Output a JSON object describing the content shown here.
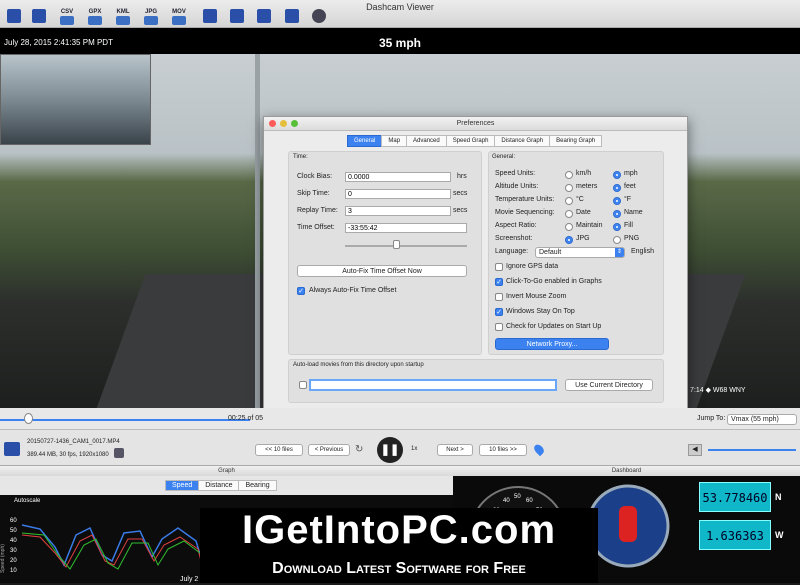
{
  "window": {
    "title": "Dashcam Viewer"
  },
  "toolbar": {
    "buttons": [
      "CSV",
      "GPX",
      "KML",
      "JPG",
      "MOV"
    ]
  },
  "video": {
    "timestamp": "July 28, 2015 2:41:35 PM PDT",
    "speed": "35 mph",
    "overlay_text": "7:14  ◆ W68 WNY"
  },
  "preferences": {
    "title": "Preferences",
    "tabs": [
      "General",
      "Map",
      "Advanced",
      "Speed Graph",
      "Distance Graph",
      "Bearing Graph"
    ],
    "active_tab": "General",
    "time": {
      "section": "Time:",
      "clock_bias_label": "Clock Bias:",
      "clock_bias": "0.0000",
      "clock_bias_unit": "hrs",
      "skip_time_label": "Skip Time:",
      "skip_time": "0",
      "skip_time_unit": "secs",
      "replay_time_label": "Replay Time:",
      "replay_time": "3",
      "replay_time_unit": "secs",
      "time_offset_label": "Time Offset:",
      "time_offset": "-33:55:42",
      "slider_fraction": 0.42,
      "autofix_button": "Auto-Fix Time Offset Now",
      "always_autofix": "Always Auto-Fix Time Offset",
      "always_autofix_checked": true
    },
    "general": {
      "section": "General:",
      "speed_units": {
        "label": "Speed Units:",
        "opt1": "km/h",
        "opt2": "mph",
        "selected": "mph"
      },
      "altitude_units": {
        "label": "Altitude Units:",
        "opt1": "meters",
        "opt2": "feet",
        "selected": "feet"
      },
      "temperature_units": {
        "label": "Temperature Units:",
        "opt1": "°C",
        "opt2": "°F",
        "selected": "°F"
      },
      "movie_sequencing": {
        "label": "Movie Sequencing:",
        "opt1": "Date",
        "opt2": "Name",
        "selected": "Name"
      },
      "aspect_ratio": {
        "label": "Aspect Ratio:",
        "opt1": "Maintain",
        "opt2": "Fill",
        "selected": "Fill"
      },
      "screenshot": {
        "label": "Screenshot:",
        "opt1": "JPG",
        "opt2": "PNG",
        "selected": "JPG"
      },
      "language": {
        "label": "Language:",
        "value": "Default",
        "extra": "English"
      },
      "checks": [
        {
          "label": "Ignore GPS data",
          "checked": false
        },
        {
          "label": "Click-To-Go enabled in Graphs",
          "checked": true
        },
        {
          "label": "Invert Mouse Zoom",
          "checked": false
        },
        {
          "label": "Windows Stay On Top",
          "checked": true
        },
        {
          "label": "Check for Updates on Start Up",
          "checked": false
        }
      ],
      "network_proxy": "Network Proxy..."
    },
    "autoload": {
      "label": "Auto-load movies from this directory upon startup",
      "path": "",
      "button": "Use Current Directory"
    }
  },
  "scrubber": {
    "time": "00:25 of 05",
    "jump_label": "Jump To:",
    "jump_value": "Vmax (55 mph)",
    "progress": 0.03
  },
  "controls": {
    "filename": "20150727-1436_CAM1_0017.MP4",
    "fileinfo": "389.44 MB, 30 fps, 1920x1080",
    "prev10": "<< 10 files",
    "prev": "< Previous",
    "next": "Next >",
    "next10": "10 files >>",
    "speed_label": "1x"
  },
  "graph": {
    "title": "Graph",
    "tabs": [
      "Speed",
      "Distance",
      "Bearing"
    ],
    "active": "Speed",
    "autoscale": "Autoscale",
    "ylabel": "Speed (mph)",
    "yticks": [
      "60",
      "50",
      "40",
      "30",
      "20",
      "10"
    ],
    "xlabel": "July 2"
  },
  "dashboard": {
    "title": "Dashboard",
    "lat": "53.778460",
    "lat_dir": "N",
    "lon": "1.636363",
    "lon_dir": "W",
    "gauge_ticks": [
      "30",
      "40",
      "50",
      "60",
      "70"
    ]
  },
  "watermark": {
    "line1": "IGetIntoPC.com",
    "line2": "Download Latest Software for Free"
  }
}
